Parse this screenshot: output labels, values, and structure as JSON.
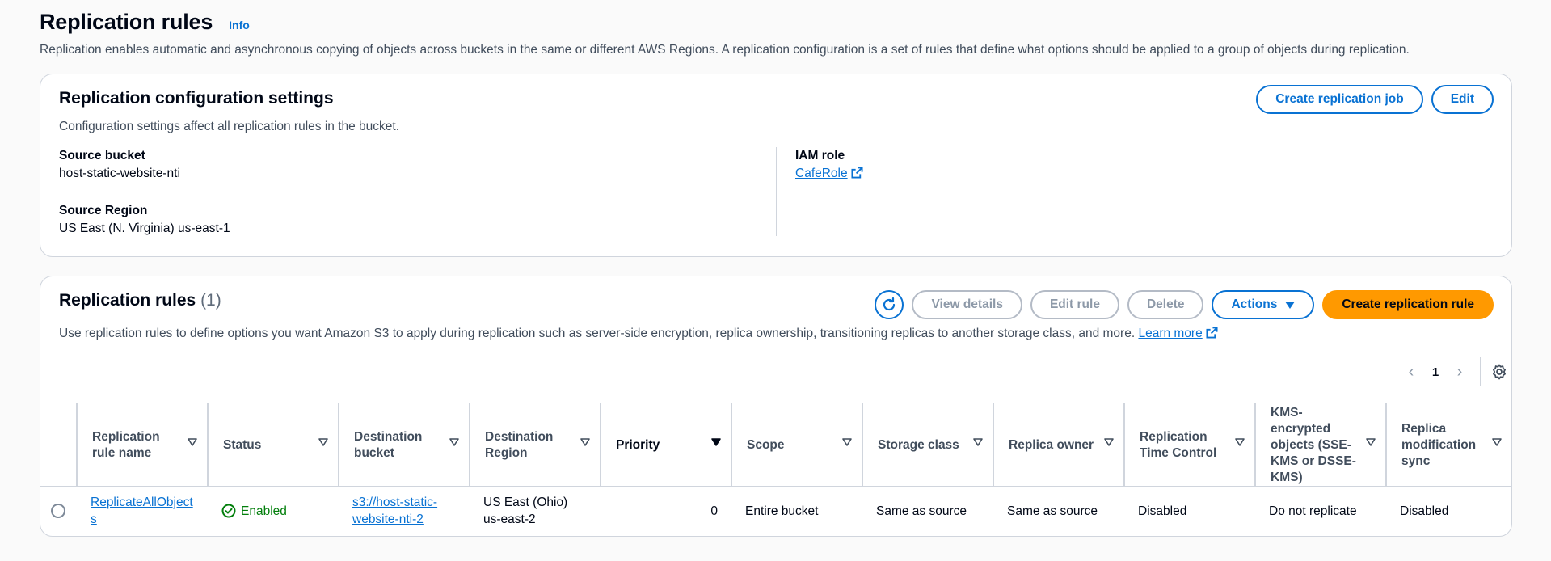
{
  "header": {
    "title": "Replication rules",
    "info_label": "Info",
    "description": "Replication enables automatic and asynchronous copying of objects across buckets in the same or different AWS Regions. A replication configuration is a set of rules that define what options should be applied to a group of objects during replication."
  },
  "config": {
    "title": "Replication configuration settings",
    "description": "Configuration settings affect all replication rules in the bucket.",
    "create_job_label": "Create replication job",
    "edit_label": "Edit",
    "source_bucket_label": "Source bucket",
    "source_bucket_value": "host-static-website-nti",
    "source_region_label": "Source Region",
    "source_region_value": "US East (N. Virginia) us-east-1",
    "iam_role_label": "IAM role",
    "iam_role_value": "CafeRole"
  },
  "rules": {
    "title": "Replication rules",
    "count": "(1)",
    "description": "Use replication rules to define options you want Amazon S3 to apply during replication such as server-side encryption, replica ownership, transitioning replicas to another storage class, and more.",
    "learn_more": "Learn more",
    "view_details_label": "View details",
    "edit_rule_label": "Edit rule",
    "delete_label": "Delete",
    "actions_label": "Actions",
    "create_rule_label": "Create replication rule",
    "page_number": "1",
    "columns": [
      "Replication rule name",
      "Status",
      "Destination bucket",
      "Destination Region",
      "Priority",
      "Scope",
      "Storage class",
      "Replica owner",
      "Replication Time Control",
      "KMS-encrypted objects (SSE-KMS or DSSE-KMS)",
      "Replica modification sync"
    ],
    "rows": [
      {
        "name": "ReplicateAllObjects",
        "status": "Enabled",
        "destination_bucket": "s3://host-static-website-nti-2",
        "destination_region": "US East (Ohio) us-east-2",
        "priority": "0",
        "scope": "Entire bucket",
        "storage_class": "Same as source",
        "replica_owner": "Same as source",
        "replication_time_control": "Disabled",
        "kms_encrypted": "Do not replicate",
        "replica_modification_sync": "Disabled"
      }
    ]
  },
  "colors": {
    "link": "#0972d3",
    "primary_button": "#ff9900",
    "success": "#037f0c",
    "border": "#d0d5dd"
  },
  "icons": [
    "external-link-icon",
    "refresh-icon",
    "caret-down-icon",
    "sort-icon",
    "chevron-left-icon",
    "chevron-right-icon",
    "settings-gear-icon",
    "status-check-icon"
  ]
}
